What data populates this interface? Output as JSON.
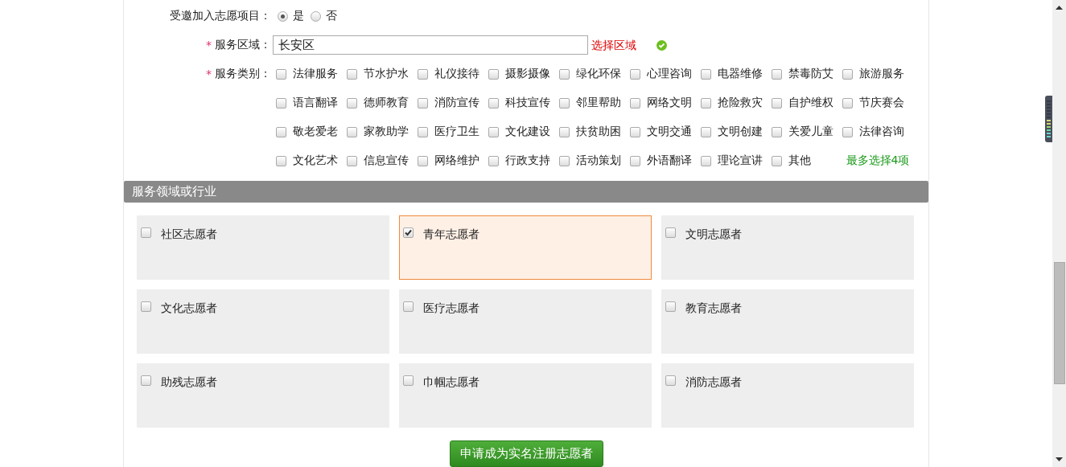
{
  "invite": {
    "label": "受邀加入志愿项目：",
    "options": [
      {
        "label": "是",
        "selected": true
      },
      {
        "label": "否",
        "selected": false
      }
    ]
  },
  "region": {
    "required_mark": "*",
    "label": "服务区域：",
    "value": "长安区",
    "link": "选择区域",
    "valid": true
  },
  "categories": {
    "required_mark": "*",
    "label": "服务类别：",
    "hint": "最多选择4项",
    "options": [
      {
        "label": "法律服务",
        "checked": false
      },
      {
        "label": "节水护水",
        "checked": false
      },
      {
        "label": "礼仪接待",
        "checked": false
      },
      {
        "label": "摄影摄像",
        "checked": false
      },
      {
        "label": "绿化环保",
        "checked": false
      },
      {
        "label": "心理咨询",
        "checked": false
      },
      {
        "label": "电器维修",
        "checked": false
      },
      {
        "label": "禁毒防艾",
        "checked": false
      },
      {
        "label": "旅游服务",
        "checked": false
      },
      {
        "label": "语言翻译",
        "checked": false
      },
      {
        "label": "德师教育",
        "checked": false
      },
      {
        "label": "消防宣传",
        "checked": false
      },
      {
        "label": "科技宣传",
        "checked": false
      },
      {
        "label": "邻里帮助",
        "checked": false
      },
      {
        "label": "网络文明",
        "checked": false
      },
      {
        "label": "抢险救灾",
        "checked": false
      },
      {
        "label": "自护维权",
        "checked": false
      },
      {
        "label": "节庆赛会",
        "checked": false
      },
      {
        "label": "敬老爱老",
        "checked": false
      },
      {
        "label": "家教助学",
        "checked": false
      },
      {
        "label": "医疗卫生",
        "checked": false
      },
      {
        "label": "文化建设",
        "checked": false
      },
      {
        "label": "扶贫助困",
        "checked": false
      },
      {
        "label": "文明交通",
        "checked": false
      },
      {
        "label": "文明创建",
        "checked": false
      },
      {
        "label": "关爱儿童",
        "checked": false
      },
      {
        "label": "法律咨询",
        "checked": false
      },
      {
        "label": "文化艺术",
        "checked": false
      },
      {
        "label": "信息宣传",
        "checked": false
      },
      {
        "label": "网络维护",
        "checked": false
      },
      {
        "label": "行政支持",
        "checked": false
      },
      {
        "label": "活动策划",
        "checked": false
      },
      {
        "label": "外语翻译",
        "checked": false
      },
      {
        "label": "理论宣讲",
        "checked": false
      },
      {
        "label": "其他",
        "checked": false
      }
    ]
  },
  "section": {
    "title": "服务领域或行业"
  },
  "cards": [
    {
      "label": "社区志愿者",
      "checked": false
    },
    {
      "label": "青年志愿者",
      "checked": true
    },
    {
      "label": "文明志愿者",
      "checked": false
    },
    {
      "label": "文化志愿者",
      "checked": false
    },
    {
      "label": "医疗志愿者",
      "checked": false
    },
    {
      "label": "教育志愿者",
      "checked": false
    },
    {
      "label": "助残志愿者",
      "checked": false
    },
    {
      "label": "巾帼志愿者",
      "checked": false
    },
    {
      "label": "消防志愿者",
      "checked": false
    }
  ],
  "submit": {
    "label": "申请成为实名注册志愿者"
  }
}
